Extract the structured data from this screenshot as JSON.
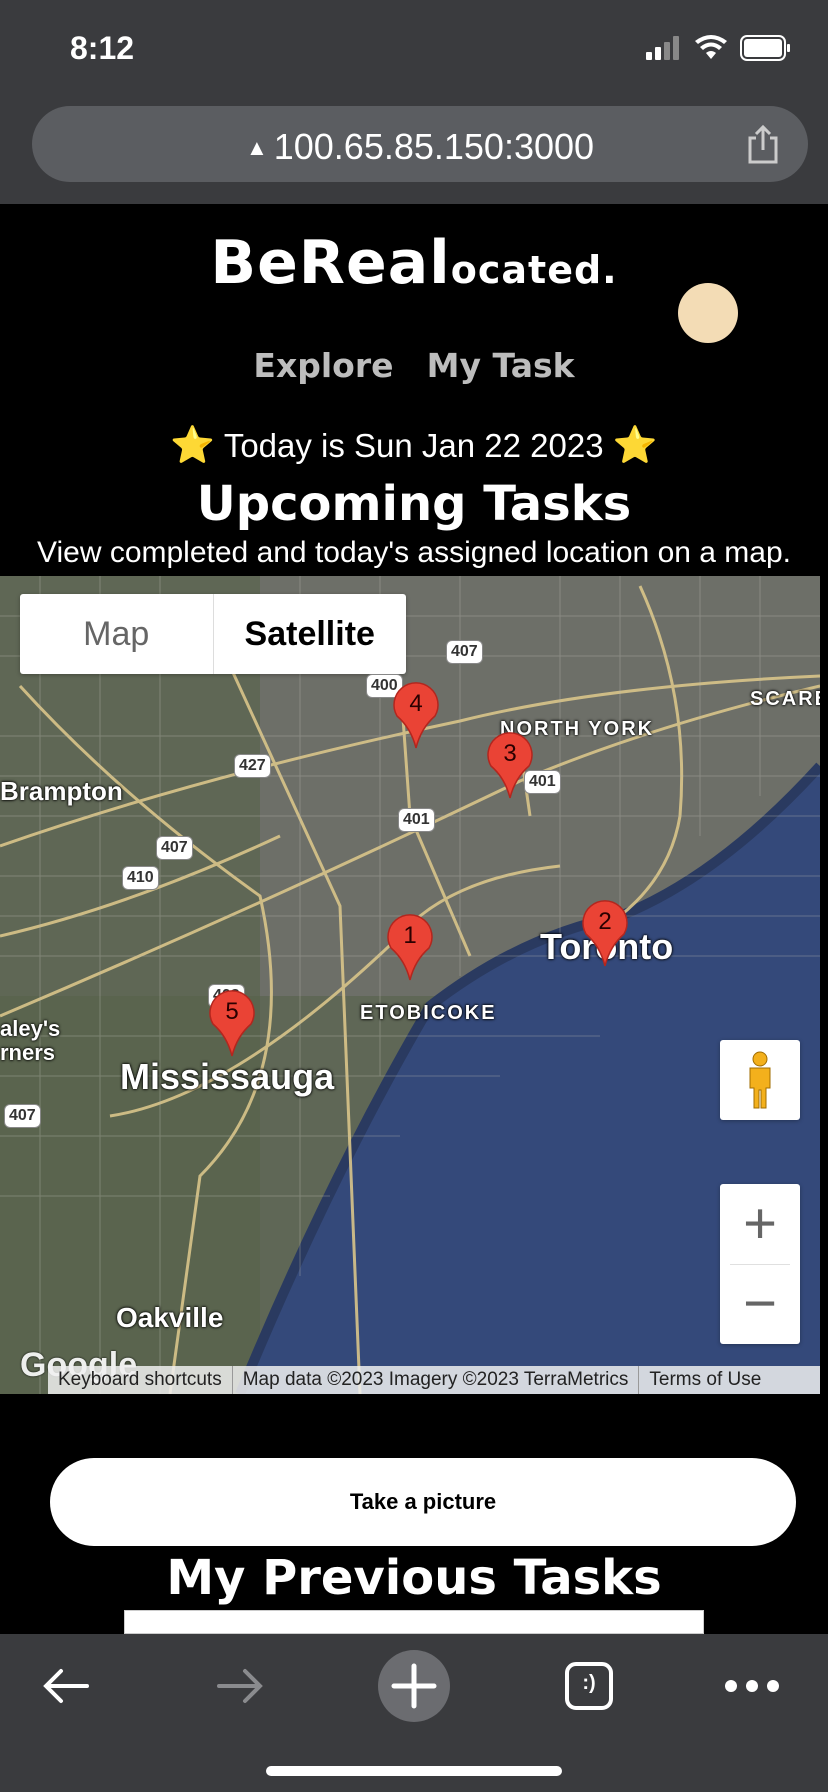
{
  "status_bar": {
    "time": "8:12"
  },
  "browser": {
    "url": "100.65.85.150:3000",
    "icons": [
      "signal-icon",
      "wifi-icon",
      "battery-icon",
      "warning-icon",
      "share-icon"
    ]
  },
  "header": {
    "logo_big": "BeReal",
    "logo_small": "ocated.",
    "nav": [
      "Explore",
      "My Task"
    ]
  },
  "main": {
    "date_prefix_star": "⭐",
    "date_text": "Today is Sun Jan 22 2023",
    "date_suffix_star": "⭐",
    "title": "Upcoming Tasks",
    "subtitle": "View completed and today's assigned location on a map."
  },
  "map": {
    "type_buttons": {
      "map": "Map",
      "satellite": "Satellite",
      "selected": "Satellite"
    },
    "places": {
      "brampton": "Brampton",
      "mississauga": "Mississauga",
      "oakville": "Oakville",
      "toronto": "Toronto",
      "etobicoke": "ETOBICOKE",
      "north_york": "NORTH YORK",
      "scarb": "SCARB",
      "haleys": "aley's",
      "corners": "rners"
    },
    "highways": {
      "h407a": "407",
      "h407b": "407",
      "h407c": "407",
      "h407d": "407",
      "h401a": "401",
      "h401b": "401",
      "h400": "400",
      "h427": "427",
      "h410": "410",
      "h403": "403"
    },
    "markers": [
      "1",
      "2",
      "3",
      "4",
      "5"
    ],
    "zoom_in": "+",
    "zoom_out": "−",
    "google": "Google",
    "attribution": {
      "shortcuts": "Keyboard shortcuts",
      "data": "Map data ©2023 Imagery ©2023 TerraMetrics",
      "terms": "Terms of Use"
    },
    "colors": {
      "marker": "#ea4335",
      "water": "#34497a",
      "land": "#6a7060"
    }
  },
  "actions": {
    "take_picture": "Take a picture"
  },
  "previous": {
    "title": "My Previous Tasks"
  },
  "toolbar": {
    "icons": [
      "back-icon",
      "forward-icon",
      "new-tab-icon",
      "tabs-icon",
      "more-icon"
    ],
    "tabs_label": ":)"
  }
}
